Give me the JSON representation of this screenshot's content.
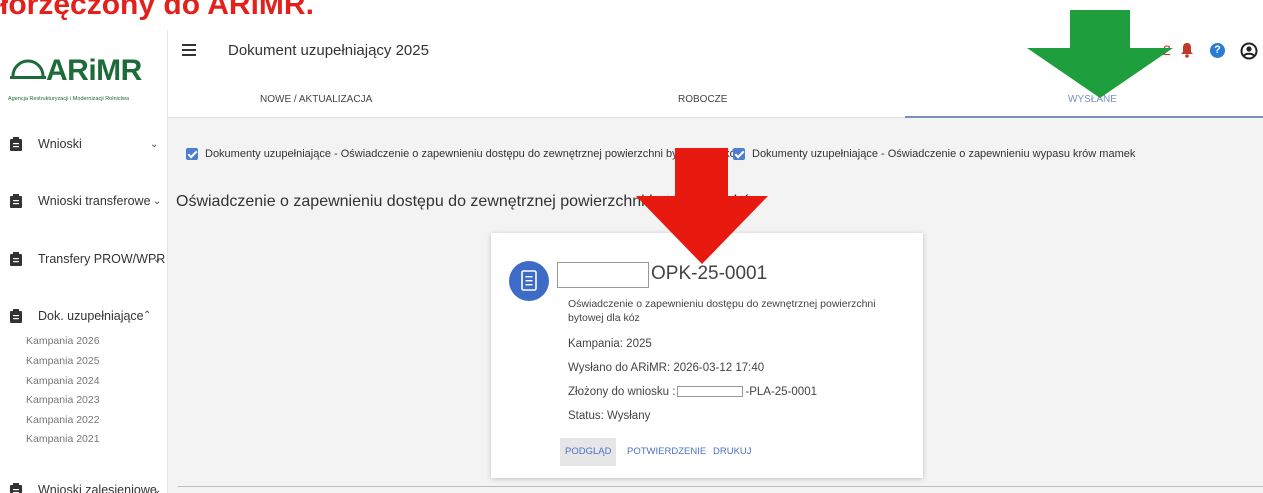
{
  "banner": {
    "text": "łorzęczony do ARiMR."
  },
  "logo": {
    "name": "ARiMR",
    "subtitle": "Agencja Restrukturyzacji i Modernizacji Rolnictwa"
  },
  "header": {
    "title": "Dokument uzupełniający 2025",
    "notifications_count": "2",
    "help_label": "?"
  },
  "tabs": [
    {
      "label": "NOWE / AKTUALIZACJA",
      "active": false
    },
    {
      "label": "ROBOCZE",
      "active": false
    },
    {
      "label": "WYSŁANE",
      "active": true
    }
  ],
  "sidebar": {
    "items": [
      {
        "label": "Wnioski",
        "chevron": "down"
      },
      {
        "label": "Wnioski transferowe",
        "chevron": "down"
      },
      {
        "label": "Transfery PROW/WPR",
        "chevron": "down"
      },
      {
        "label": "Dok. uzupełniające",
        "chevron": "up"
      },
      {
        "label": "Wnioski zalesieniowe",
        "chevron": "down"
      }
    ],
    "subitems": [
      "Kampania 2026",
      "Kampania 2025",
      "Kampania 2024",
      "Kampania 2023",
      "Kampania 2022",
      "Kampania 2021"
    ]
  },
  "filters": [
    {
      "label": "Dokumenty uzupełniające - Oświadczenie o zapewnieniu dostępu do zewnętrznej powierzchni bytowej dla kóz",
      "checked": true
    },
    {
      "label": "Dokumenty uzupełniające - Oświadczenie o zapewnieniu wypasu krów mamek",
      "checked": true
    }
  ],
  "section": {
    "title": "Oświadczenie o zapewnieniu dostępu do zewnętrznej powierzchni bytowej dla kóz"
  },
  "card": {
    "number": "OPK-25-0001",
    "description": "Oświadczenie o zapewnieniu dostępu do zewnętrznej powierzchni bytowej dla kóz",
    "campaign": "Kampania: 2025",
    "sent": "Wysłano do ARiMR: 2026-03-12 17:40",
    "submitted_prefix": "Złożony do wniosku :",
    "submitted_suffix": "-PLA-25-0001",
    "status": "Status: Wysłany",
    "buttons": [
      "PODGLĄD",
      "POTWIERDZENIE",
      "DRUKUJ"
    ]
  },
  "colors": {
    "accent": "#4a7fd4",
    "brand_green": "#1d6b39",
    "arrow_red": "#e8190f",
    "arrow_green": "#1e9e3c"
  }
}
